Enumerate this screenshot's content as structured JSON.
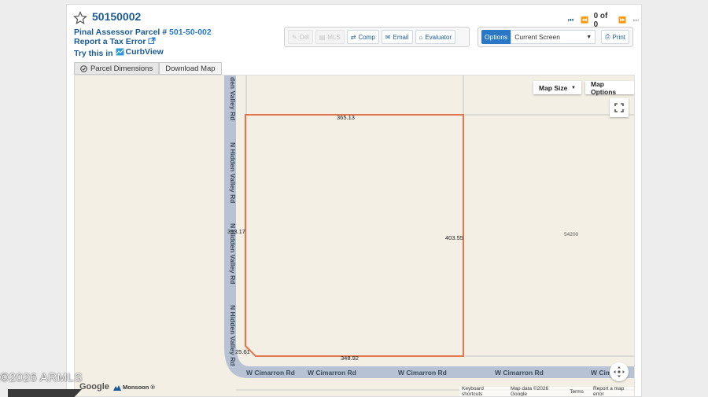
{
  "header": {
    "parcel_id": "50150002",
    "assessor_label": "Pinal Assessor Parcel #",
    "assessor_number": "501-50-002",
    "report_error": "Report a Tax Error",
    "try_this": "Try this in",
    "curbview": "CurbView",
    "nav_count": "0 of 0"
  },
  "toolbar": {
    "buttons": [
      {
        "label": "Del",
        "icon": "tag-icon",
        "enabled": false
      },
      {
        "label": "MLS",
        "icon": "mls-icon",
        "enabled": false
      },
      {
        "label": "Comp",
        "icon": "compare-icon",
        "enabled": true
      },
      {
        "label": "Email",
        "icon": "email-icon",
        "enabled": true
      },
      {
        "label": "Evaluator",
        "icon": "house-icon",
        "enabled": true
      }
    ]
  },
  "options": {
    "label": "Options",
    "selected": "Current Screen",
    "print_label": "Print"
  },
  "tabs": [
    {
      "label": "Parcel Dimensions",
      "active": true
    },
    {
      "label": "Download Map",
      "active": false
    }
  ],
  "map": {
    "controls": {
      "map_size": "Map Size",
      "map_options": "Map Options"
    },
    "dimensions": {
      "top": "365.13",
      "right": "403.55",
      "left": "393.17",
      "bottom": "348.92",
      "corner": "25.61"
    },
    "neighbor_parcel": "54200",
    "roads": {
      "hidden_valley": "N Hidden Valley Rd",
      "hidden_valley_top": "den Valley Rd",
      "cimarron": "W Cimarron Rd",
      "cimarron_partial": "W Cim"
    },
    "attribution": {
      "google": "Google",
      "monsoon": "Monsoon ®",
      "keyboard": "Keyboard shortcuts",
      "map_data": "Map data ©2026 Google",
      "terms": "Terms",
      "report": "Report a map error"
    },
    "colors": {
      "parcel_outline": "#e2774f",
      "road": "#b7c3d5",
      "land": "#f3efe5"
    }
  },
  "watermark": "2026 ARMLS"
}
